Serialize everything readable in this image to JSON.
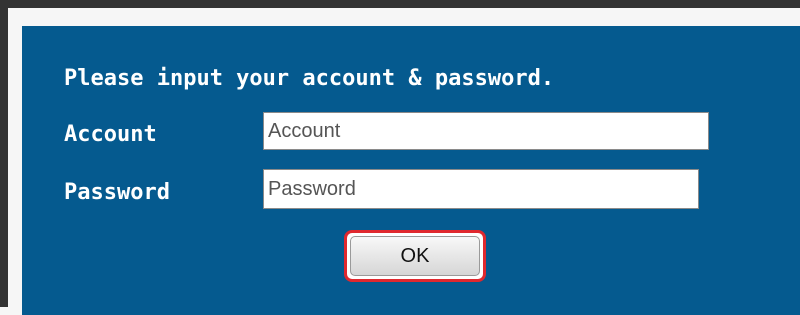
{
  "login": {
    "prompt": "Please input your account & password.",
    "account_label": "Account",
    "account_placeholder": "Account",
    "account_value": "",
    "password_label": "Password",
    "password_placeholder": "Password",
    "password_value": "",
    "ok_label": "OK"
  },
  "colors": {
    "panel_background": "#055a8f",
    "ok_highlight": "#e0282e"
  }
}
